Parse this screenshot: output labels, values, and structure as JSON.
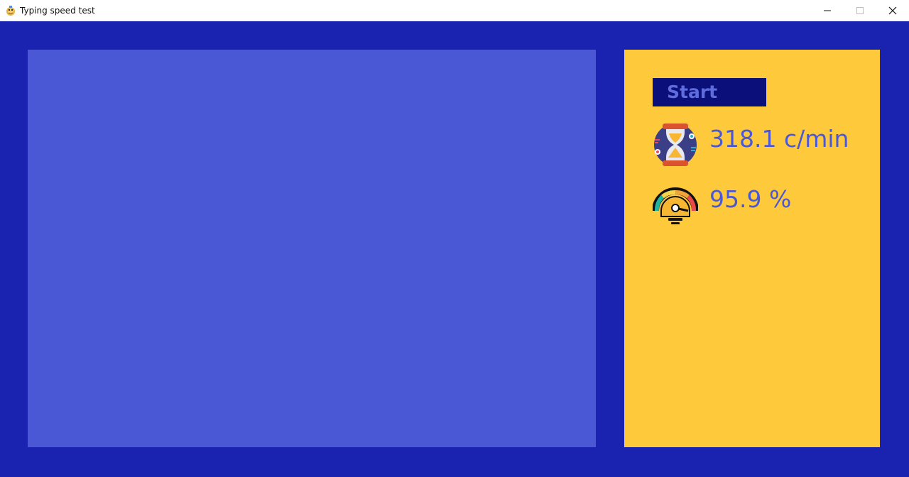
{
  "window": {
    "title": "Typing speed test",
    "icon": "pygame-snake-icon",
    "controls": {
      "minimize": "minimize-icon",
      "maximize": "maximize-icon",
      "close": "close-icon"
    }
  },
  "colors": {
    "background": "#1a22b0",
    "typing_area": "#4a58d6",
    "side_panel": "#ffc93c",
    "button_bg": "#0a0f7a",
    "button_text": "#5f6cdd",
    "stat_text": "#4a58d6"
  },
  "side_panel": {
    "start_label": "Start",
    "speed": {
      "icon": "hourglass-icon",
      "value": "318.1 c/min"
    },
    "accuracy": {
      "icon": "speedometer-icon",
      "value": "95.9 %"
    }
  }
}
